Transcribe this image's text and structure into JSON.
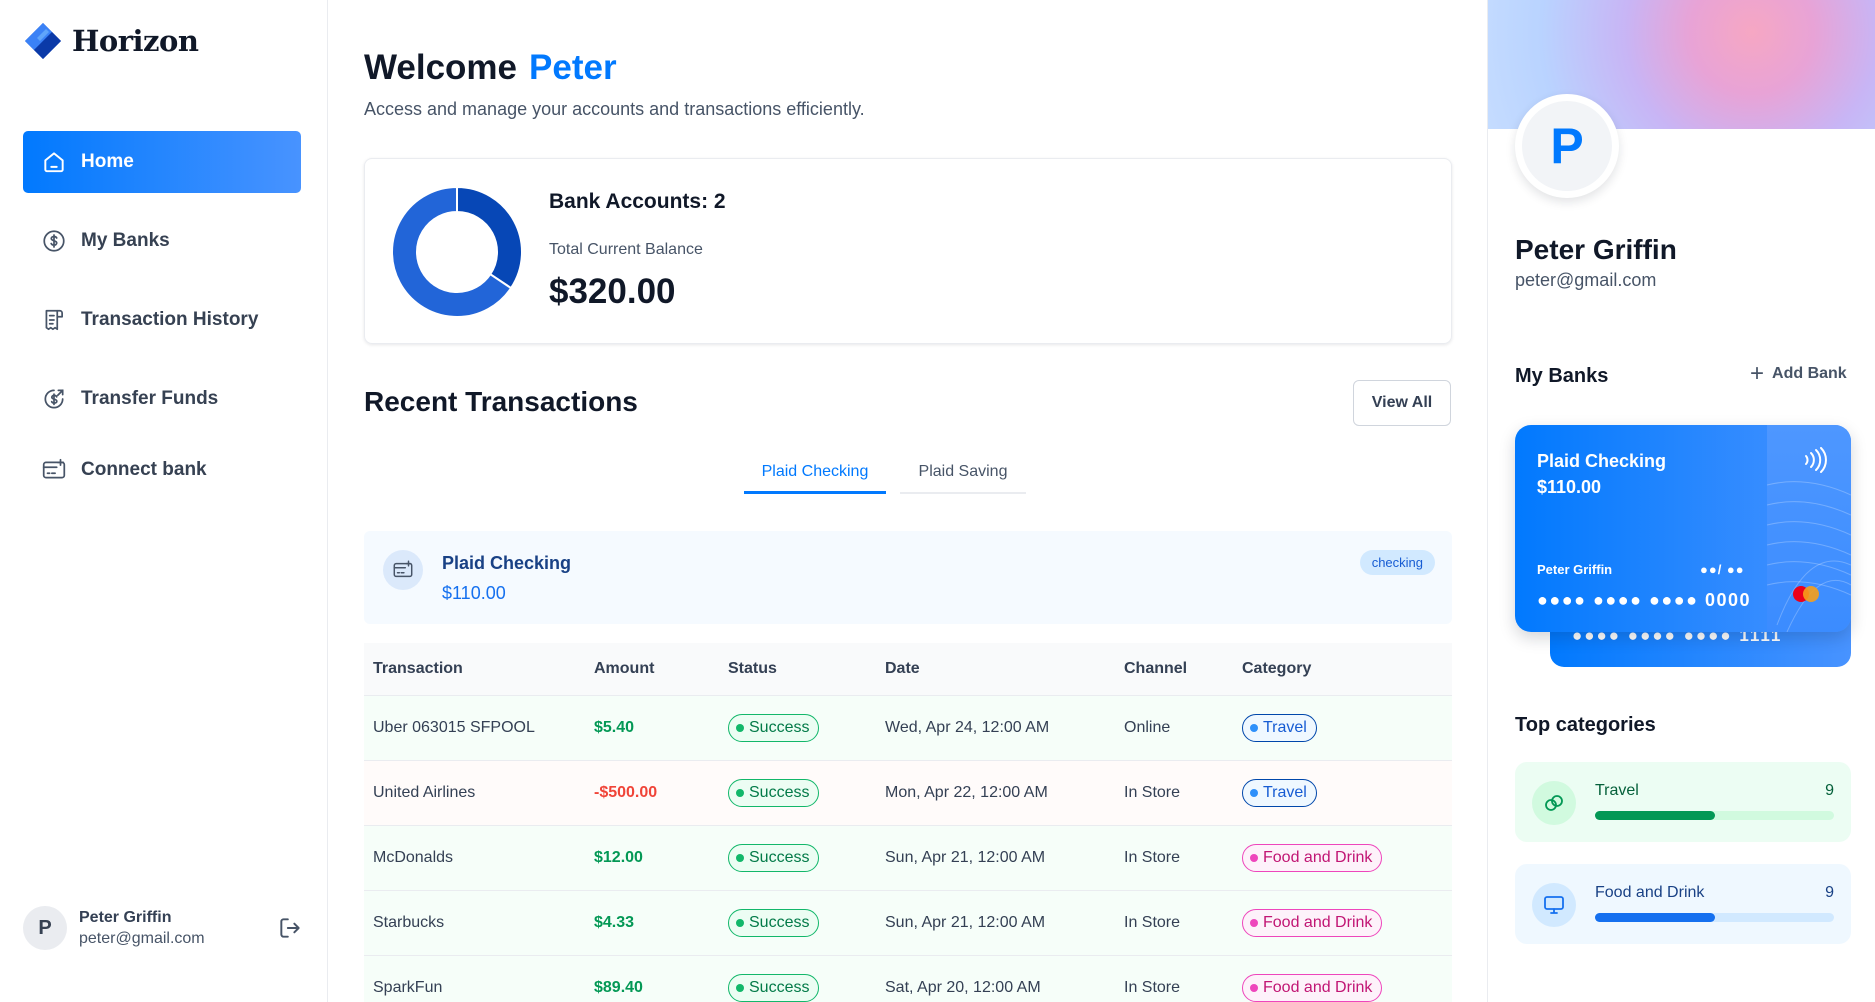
{
  "app": {
    "name": "Horizon"
  },
  "sidebar": {
    "items": [
      {
        "label": "Home",
        "icon": "home-icon",
        "active": true
      },
      {
        "label": "My Banks",
        "icon": "dollar-circle-icon"
      },
      {
        "label": "Transaction History",
        "icon": "receipt-icon"
      },
      {
        "label": "Transfer Funds",
        "icon": "money-send-icon"
      },
      {
        "label": "Connect bank",
        "icon": "connect-bank-icon"
      }
    ],
    "user": {
      "initial": "P",
      "name": "Peter Griffin",
      "email": "peter@gmail.com"
    }
  },
  "header": {
    "welcome": "Welcome",
    "user_first_name": "Peter",
    "subtitle": "Access and manage your accounts and transactions efficiently."
  },
  "balance": {
    "accounts_label": "Bank Accounts: 2",
    "total_label": "Total Current Balance",
    "total_value": "$320.00",
    "donut_segments": [
      {
        "name": "Plaid Checking",
        "value": 110,
        "color": "#0747b6"
      },
      {
        "name": "Plaid Saving",
        "value": 210,
        "color": "#2265d8"
      }
    ]
  },
  "recent": {
    "title": "Recent Transactions",
    "view_all": "View All",
    "tabs": [
      "Plaid Checking",
      "Plaid Saving"
    ],
    "active_tab": 0,
    "account": {
      "name": "Plaid Checking",
      "balance": "$110.00",
      "type": "checking"
    },
    "columns": [
      "Transaction",
      "Amount",
      "Status",
      "Date",
      "Channel",
      "Category"
    ],
    "rows": [
      {
        "name": "Uber 063015 SFPOOL",
        "amount": "$5.40",
        "sign": "pos",
        "status": "Success",
        "date": "Wed, Apr 24, 12:00 AM",
        "channel": "Online",
        "category": "Travel",
        "cat_style": "travel"
      },
      {
        "name": "United Airlines",
        "amount": "-$500.00",
        "sign": "neg",
        "status": "Success",
        "date": "Mon, Apr 22, 12:00 AM",
        "channel": "In Store",
        "category": "Travel",
        "cat_style": "travel"
      },
      {
        "name": "McDonalds",
        "amount": "$12.00",
        "sign": "pos",
        "status": "Success",
        "date": "Sun, Apr 21, 12:00 AM",
        "channel": "In Store",
        "category": "Food and Drink",
        "cat_style": "food"
      },
      {
        "name": "Starbucks",
        "amount": "$4.33",
        "sign": "pos",
        "status": "Success",
        "date": "Sun, Apr 21, 12:00 AM",
        "channel": "In Store",
        "category": "Food and Drink",
        "cat_style": "food"
      },
      {
        "name": "SparkFun",
        "amount": "$89.40",
        "sign": "pos",
        "status": "Success",
        "date": "Sat, Apr 20, 12:00 AM",
        "channel": "In Store",
        "category": "Food and Drink",
        "cat_style": "food"
      }
    ]
  },
  "profile": {
    "initial": "P",
    "name": "Peter Griffin",
    "email": "peter@gmail.com",
    "banks_title": "My Banks",
    "add_bank": "Add Bank",
    "card": {
      "name": "Plaid Checking",
      "balance": "$110.00",
      "holder": "Peter Griffin",
      "expiry": "●●/ ●●",
      "number": "●●●● ●●●● ●●●● 0000",
      "back_number": "●●●● ●●●● ●●●● 1111"
    },
    "categories_title": "Top categories",
    "categories": [
      {
        "name": "Travel",
        "count": "9",
        "progress": 0.5,
        "icon": "travel-icon"
      },
      {
        "name": "Food and Drink",
        "count": "9",
        "progress": 0.5,
        "icon": "food-drink-icon"
      }
    ]
  },
  "colors": {
    "accent": "#0179fe",
    "success": "#12b76a",
    "negative": "#f04438",
    "food": "#ee46bc"
  }
}
